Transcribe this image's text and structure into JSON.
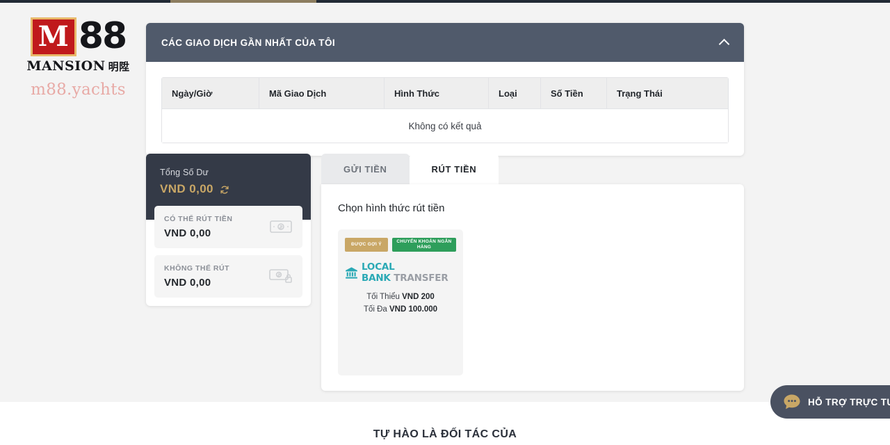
{
  "brand": {
    "mark": "M",
    "digits": "88",
    "name": "MANSION",
    "name_cjk": "明陞",
    "domain": "m88.yachts"
  },
  "transactions_panel": {
    "title": "CÁC GIAO DỊCH GẦN NHẤT CỦA TÔI",
    "collapse_icon": "chevron-up-icon",
    "columns": [
      "Ngày/Giờ",
      "Mã Giao Dịch",
      "Hình Thức",
      "Loại",
      "Số Tiền",
      "Trạng Thái"
    ],
    "empty_message": "Không có kết quả"
  },
  "balance": {
    "total_label": "Tổng Số Dư",
    "total_value": "VND  0,00",
    "refresh_icon": "refresh-icon",
    "rows": [
      {
        "label": "CÓ THỂ RÚT TIỀN",
        "value": "VND  0,00",
        "icon": "banknote-icon"
      },
      {
        "label": "KHÔNG THỂ RÚT",
        "value": "VND  0,00",
        "icon": "banknote-lock-icon"
      }
    ]
  },
  "tabs": [
    {
      "label": "GỬI TIỀN",
      "active": false
    },
    {
      "label": "RÚT TIỀN",
      "active": true
    }
  ],
  "withdraw": {
    "title": "Chọn hình thức rút tiền",
    "method": {
      "badge_recommended": "ĐƯỢC GỢI Ý",
      "badge_type": "CHUYỂN KHOẢN NGÂN HÀNG",
      "logo_icon": "bank-building-icon",
      "logo_primary": "LOCAL BANK",
      "logo_secondary": "TRANSFER",
      "min_label": "Tối Thiểu",
      "min_value": "VND 200",
      "max_label": "Tối Đa",
      "max_value": "VND 100.000"
    }
  },
  "footer": {
    "partners_title": "TỰ HÀO LÀ ĐỐI TÁC CỦA"
  },
  "chat": {
    "icon": "chat-bubble-icon",
    "label": "HỖ TRỢ TRỰC TUYẾN"
  },
  "colors": {
    "panel_header": "#505a6b",
    "balance_header": "#343a47",
    "gold": "#c9a766",
    "bank_green": "#2e9e5b",
    "logo_teal": "#2aa9b5",
    "background": "#f3f3f3",
    "brand_red": "#c0191c"
  }
}
